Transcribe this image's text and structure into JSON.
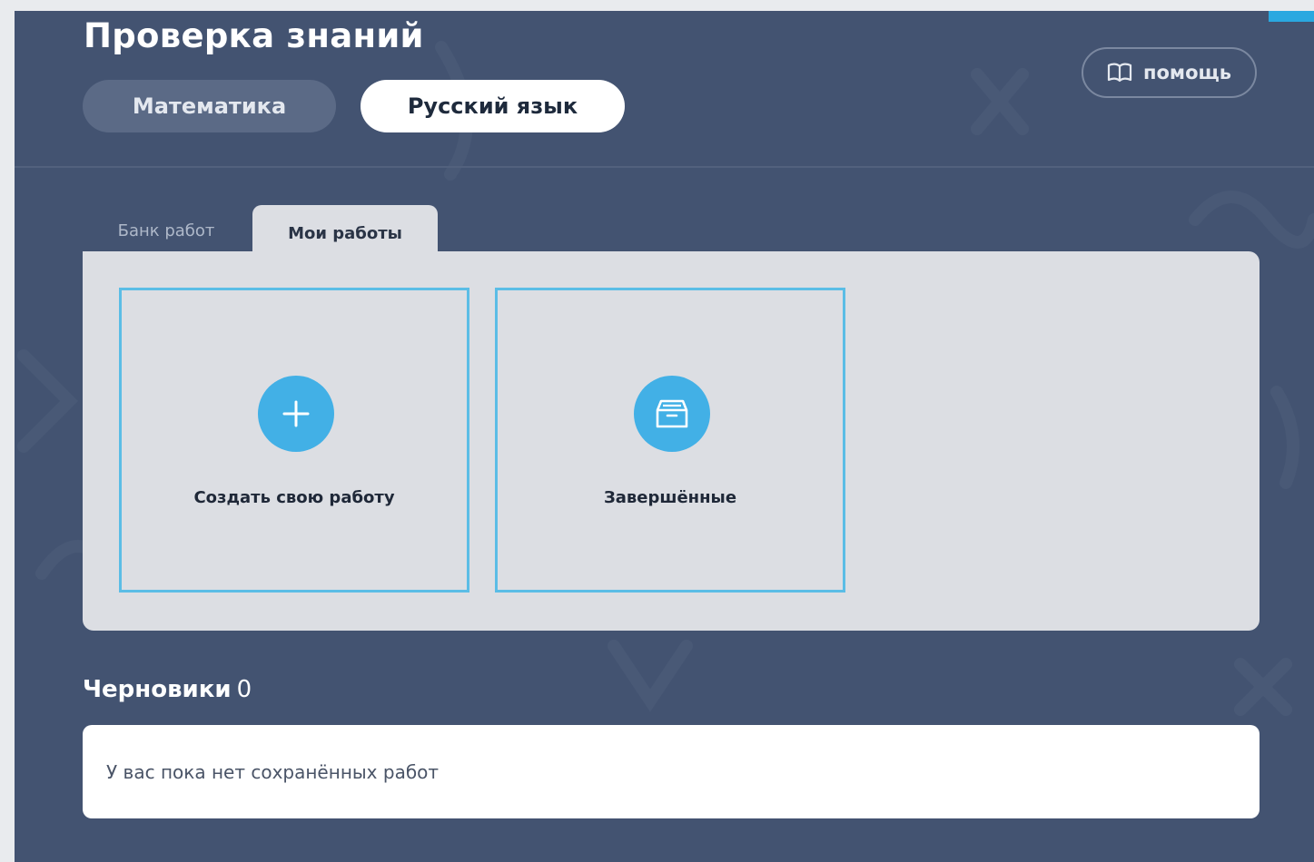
{
  "header": {
    "title": "Проверка знаний",
    "help_label": "помощь",
    "help_icon": "book-icon"
  },
  "subjects": {
    "math_label": "Математика",
    "russian_label": "Русский язык",
    "active": "Русский язык"
  },
  "tabs": {
    "bank_label": "Банк работ",
    "mine_label": "Мои работы",
    "active": "Мои работы"
  },
  "cards": {
    "create": {
      "label": "Создать свою работу",
      "icon": "plus-icon"
    },
    "finished": {
      "label": "Завершённые",
      "icon": "archive-box-icon"
    }
  },
  "drafts": {
    "heading": "Черновики",
    "count": "0",
    "empty_text": "У вас пока нет сохранённых работ"
  },
  "colors": {
    "background": "#435371",
    "accent": "#42b0e6",
    "card_border": "#5bbde6",
    "panel": "#dcdee3"
  }
}
